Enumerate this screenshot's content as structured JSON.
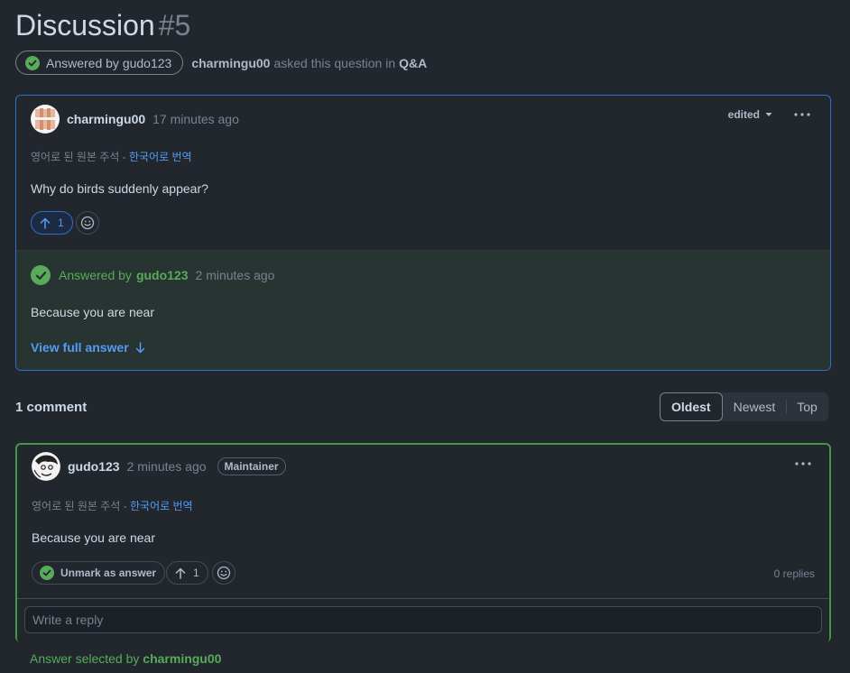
{
  "page": {
    "title": "Discussion",
    "number": "#5",
    "answered_badge": "Answered by gudo123",
    "author": "charmingu00",
    "asked_text": "asked this question in",
    "category": "Q&A"
  },
  "question": {
    "author": "charmingu00",
    "time": "17 minutes ago",
    "edited_label": "edited",
    "original_note": "영어로 된 원본 주석 -",
    "translate_link": "한국어로 번역",
    "body": "Why do birds suddenly appear?",
    "upvotes": "1"
  },
  "answer_preview": {
    "label": "Answered by",
    "author": "gudo123",
    "time": "2 minutes ago",
    "body": "Because you are near",
    "view_full": "View full answer"
  },
  "comments": {
    "count_label": "1 comment",
    "sort_options": [
      "Oldest",
      "Newest",
      "Top"
    ],
    "selected_sort": "Oldest"
  },
  "comment": {
    "author": "gudo123",
    "time": "2 minutes ago",
    "badge": "Maintainer",
    "original_note": "영어로 된 원본 주석 -",
    "translate_link": "한국어로 번역",
    "body": "Because you are near",
    "unmark_label": "Unmark as answer",
    "upvotes": "1",
    "replies": "0 replies",
    "reply_placeholder": "Write a reply"
  },
  "footer": {
    "selected_by_text": "Answer selected by",
    "selected_by_user": "charmingu00"
  },
  "colors": {
    "background": "#22272e",
    "accent_blue": "#539bf5",
    "success_green": "#57ab5a",
    "answer_bg": "#283431",
    "border": "#444c56"
  },
  "icons": [
    "check-circle-icon",
    "chevron-down-icon",
    "kebab-icon",
    "arrow-up-icon",
    "smiley-icon",
    "arrow-down-icon"
  ]
}
